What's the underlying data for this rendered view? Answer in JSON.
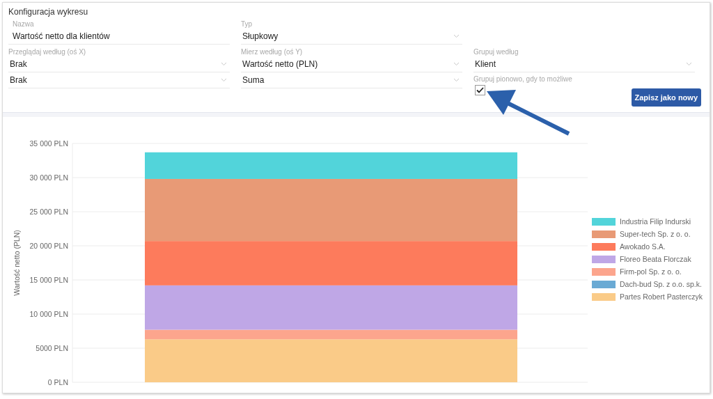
{
  "config": {
    "title": "Konfiguracja wykresu",
    "rows": [
      [
        {
          "kind": "text",
          "label": "Nazwa",
          "value": "Wartość netto dla klientów"
        },
        {
          "kind": "select",
          "label": "Typ",
          "value": "Słupkowy"
        }
      ],
      [
        {
          "kind": "select",
          "label": "Przeglądaj według (oś X)",
          "value": "Brak"
        },
        {
          "kind": "select",
          "label": "Mierz według (oś Y)",
          "value": "Wartość netto (PLN)"
        },
        {
          "kind": "select",
          "label": "Grupuj według",
          "value": "Klient"
        }
      ],
      [
        {
          "kind": "select",
          "value": "Brak"
        },
        {
          "kind": "select",
          "value": "Suma"
        },
        {
          "kind": "checkbox",
          "label": "Grupuj pionowo, gdy to możliwe",
          "checked": true
        }
      ]
    ],
    "save_button": "Zapisz jako nowy"
  },
  "chart": {
    "chart_data": {
      "type": "bar",
      "stacked": true,
      "grid": true,
      "ylabel": "Wartość netto (PLN)",
      "ylim": [
        0,
        35000
      ],
      "yticks": [
        {
          "value": 0,
          "label": "0 PLN"
        },
        {
          "value": 5000,
          "label": "5000 PLN"
        },
        {
          "value": 10000,
          "label": "10 000 PLN"
        },
        {
          "value": 15000,
          "label": "15 000 PLN"
        },
        {
          "value": 20000,
          "label": "20 000 PLN"
        },
        {
          "value": 25000,
          "label": "25 000 PLN"
        },
        {
          "value": 30000,
          "label": "30 000 PLN"
        },
        {
          "value": 35000,
          "label": "35 000 PLN"
        }
      ],
      "series": [
        {
          "name": "Industria Filip Indurski",
          "color": "#52d4da",
          "values": [
            3900
          ]
        },
        {
          "name": "Super-tech Sp. z o. o.",
          "color": "#e89a76",
          "values": [
            9100
          ]
        },
        {
          "name": "Awokado S.A.",
          "color": "#fd7b5c",
          "values": [
            6500
          ]
        },
        {
          "name": "Floreo Beata Florczak",
          "color": "#bfa7e6",
          "values": [
            6500
          ]
        },
        {
          "name": "Firm-pol Sp. z o. o.",
          "color": "#fca58d",
          "values": [
            1400
          ]
        },
        {
          "name": "Dach-bud Sp. z o.o. sp.k.",
          "color": "#6aaad4",
          "values": [
            0
          ]
        },
        {
          "name": "Partes Robert Pasterczyk",
          "color": "#facb88",
          "values": [
            6300
          ]
        }
      ]
    }
  }
}
